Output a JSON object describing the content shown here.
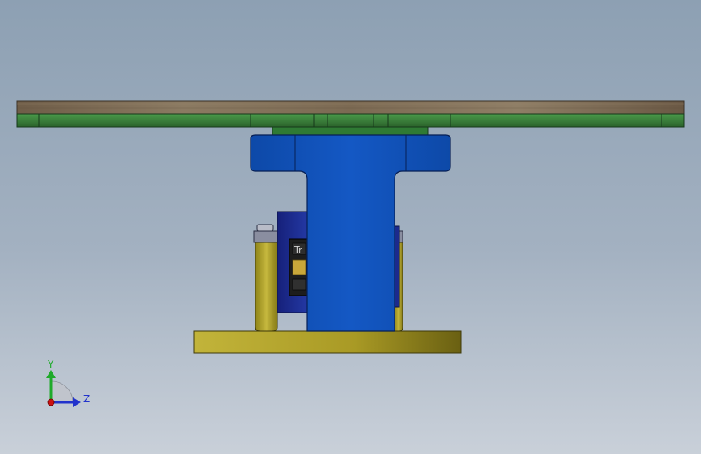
{
  "viewport": {
    "background_top": "#8da0b3",
    "background_bottom": "#c9d0d9"
  },
  "model": {
    "colors": {
      "wood_top": "#8a7a63",
      "wood_edge": "#5e5040",
      "green_plate": "#3b7d3b",
      "green_hub": "#2f6b2f",
      "blue_column": "#1152b8",
      "blue_dark": "#0a3a8a",
      "navy_motor": "#1c2a8c",
      "yellow_base": "#b3a52a",
      "yellow_dark": "#6e6514",
      "connector_black": "#1a1a1a",
      "connector_gold": "#c9a73a"
    },
    "connector_label": "Tr"
  },
  "triad": {
    "y_label": "Y",
    "z_label": "Z",
    "y_color": "#1faa2a",
    "z_color": "#2233cc",
    "origin_color": "#cc1111"
  }
}
